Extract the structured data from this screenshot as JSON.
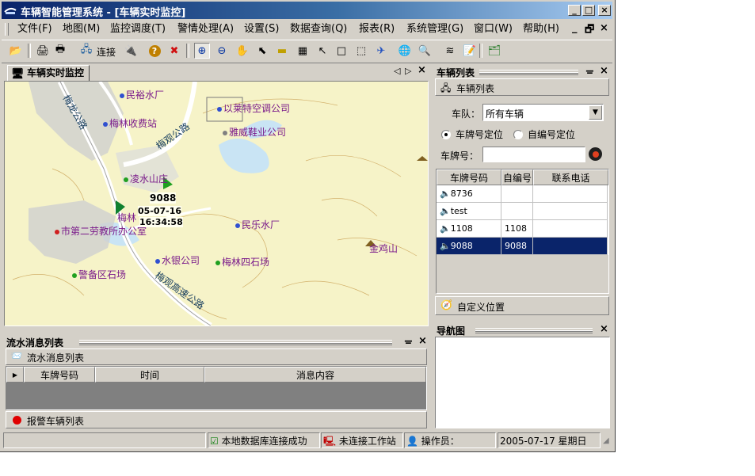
{
  "window": {
    "title": "车辆智能管理系统 - [车辆实时监控]"
  },
  "menu": [
    "文件(F)",
    "地图(M)",
    "监控调度(T)",
    "警情处理(A)",
    "设置(S)",
    "数据查询(Q)",
    "报表(R)",
    "系统管理(G)",
    "窗口(W)",
    "帮助(H)"
  ],
  "toolbar": {
    "connect_label": "连接"
  },
  "map_panel": {
    "tab_label": "车辆实时监控",
    "vehicle": {
      "plate": "9088",
      "date": "05-07-16",
      "time": "16:34:58"
    },
    "places": [
      "民裕水厂",
      "梅林收费站",
      "以莱特空调公司",
      "雅威鞋业公司",
      "凌水山庄",
      "梅林",
      "市第二劳教所办公室",
      "民乐水厂",
      "金鸡山",
      "水银公司",
      "梅林四石场",
      "警备区石场"
    ],
    "roads": [
      "梅龙公路",
      "梅观公路",
      "梅观高速公路"
    ]
  },
  "vehicle_list": {
    "panel_title": "车辆列表",
    "tab_label": "车辆列表",
    "fleet_label": "车队：",
    "fleet_value": "所有车辆",
    "radio_plate": "车牌号定位",
    "radio_selfno": "自编号定位",
    "plate_label": "车牌号：",
    "plate_value": "",
    "columns": [
      "车牌号码",
      "自编号",
      "联系电话"
    ],
    "rows": [
      {
        "plate": "8736",
        "selfno": "",
        "phone": ""
      },
      {
        "plate": "test",
        "selfno": "",
        "phone": ""
      },
      {
        "plate": "1108",
        "selfno": "1108",
        "phone": ""
      },
      {
        "plate": "9088",
        "selfno": "9088",
        "phone": ""
      }
    ],
    "custom_location": "自定义位置"
  },
  "nav_panel": {
    "title": "导航图"
  },
  "flow_panel": {
    "title": "流水消息列表",
    "tab_label": "流水消息列表",
    "columns": [
      "车牌号码",
      "时间",
      "消息内容"
    ],
    "alarm_tab": "报警车辆列表"
  },
  "status": {
    "db": "本地数据库连接成功",
    "workstation": "未连接工作站",
    "operator": "操作员：",
    "date": "2005-07-17  星期日"
  }
}
